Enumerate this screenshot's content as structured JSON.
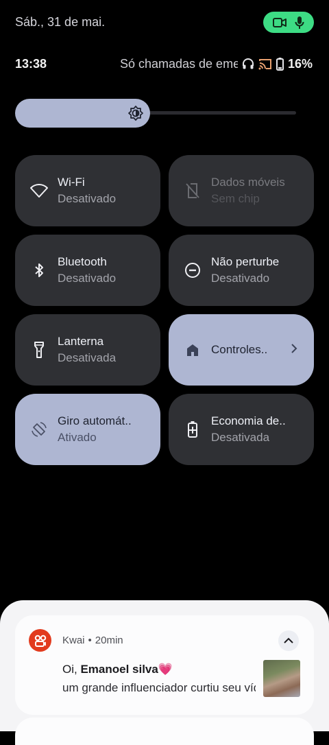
{
  "status": {
    "date": "Sáb., 31 de mai.",
    "time": "13:38",
    "carrier": "Só chamadas de emergência",
    "battery_pct": "16%",
    "privacy_chip_color": "#3ddc84"
  },
  "brightness": {
    "level_fraction": 0.48,
    "fill_color": "#aeb6d2"
  },
  "tiles": [
    {
      "label": "Wi-Fi",
      "state": "Desativado",
      "icon": "wifi-icon",
      "active": false
    },
    {
      "label": "Dados móveis",
      "state": "Sem chip",
      "icon": "no-sim-icon",
      "active": false,
      "disabled": true
    },
    {
      "label": "Bluetooth",
      "state": "Desativado",
      "icon": "bluetooth-icon",
      "active": false
    },
    {
      "label": "Não perturbe",
      "state": "Desativado",
      "icon": "do-not-disturb-icon",
      "active": false
    },
    {
      "label": "Lanterna",
      "state": "Desativada",
      "icon": "flashlight-icon",
      "active": false
    },
    {
      "label": "Controles..",
      "state": "",
      "icon": "home-icon",
      "active": true
    },
    {
      "label": "Giro automát..",
      "state": "Ativado",
      "icon": "auto-rotate-icon",
      "active": true
    },
    {
      "label": "Economia de..",
      "state": "Desativada",
      "icon": "battery-saver-icon",
      "active": false
    }
  ],
  "notification": {
    "app_name": "Kwai",
    "separator": "•",
    "time_ago": "20min",
    "title_prefix": "Oi, ",
    "title_name": "Emanoel silva💗",
    "body": "um grande influenciador curtiu seu vídeo",
    "app_color": "#e23b1e"
  }
}
